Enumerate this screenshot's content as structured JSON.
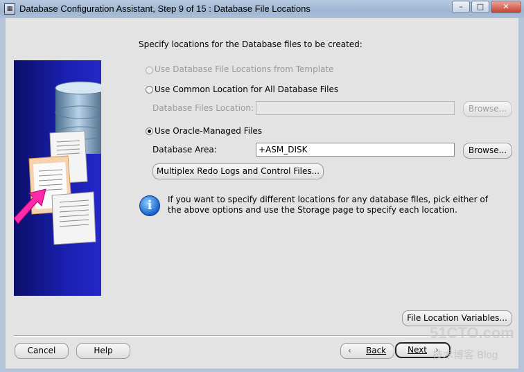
{
  "window": {
    "title": "Database Configuration Assistant, Step 9 of 15 : Database File Locations",
    "minimize": "–",
    "maximize": "□",
    "close": "✕"
  },
  "content": {
    "heading": "Specify locations for the Database files to be created:",
    "options": [
      {
        "label": "Use Database File Locations from Template",
        "selected": false,
        "enabled": false
      },
      {
        "label": "Use Common Location for All Database Files",
        "selected": false,
        "enabled": true
      },
      {
        "label": "Use Oracle-Managed Files",
        "selected": true,
        "enabled": true
      }
    ],
    "common_location": {
      "label": "Database Files Location:",
      "value": "",
      "browse": "Browse..."
    },
    "omf": {
      "label": "Database Area:",
      "value": "+ASM_DISK",
      "browse": "Browse...",
      "multiplex_button": "Multiplex Redo Logs and Control Files..."
    },
    "info": {
      "icon": "info-icon",
      "text": "If you want to specify different locations for any database files, pick either of the above options and use the Storage page to specify each location."
    },
    "file_location_variables": "File Location Variables..."
  },
  "footer": {
    "cancel": "Cancel",
    "help": "Help",
    "back": "Back",
    "next": "Next"
  },
  "watermark": {
    "line1": "51CTO.com",
    "line2": "技术博客  Blog"
  }
}
